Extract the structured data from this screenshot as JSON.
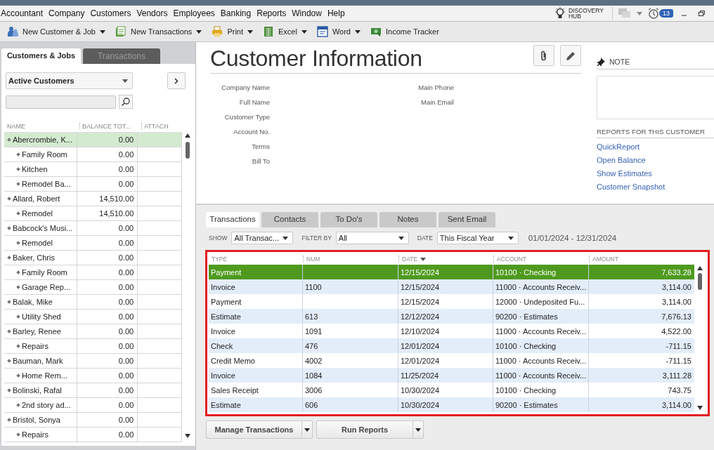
{
  "menu_bar": {
    "items": [
      "Accountant",
      "Company",
      "Customers",
      "Vendors",
      "Employees",
      "Banking",
      "Reports",
      "Window",
      "Help"
    ],
    "discovery_hub": "DISCOVERY HUB",
    "alerts_badge": "13"
  },
  "toolbar": {
    "items": [
      {
        "label": "New Customer & Job",
        "caret": true
      },
      {
        "label": "New Transactions",
        "caret": true
      },
      {
        "label": "Print",
        "caret": true
      },
      {
        "label": "Excel",
        "caret": true
      },
      {
        "label": "Word",
        "caret": true
      },
      {
        "label": "Income Tracker",
        "caret": false
      }
    ]
  },
  "customer_center": {
    "tabs": [
      {
        "label": "Customers & Jobs",
        "selected": true
      },
      {
        "label": "Transactions",
        "selected": false
      }
    ],
    "view_filter": "Active Customers",
    "columns": [
      "NAME",
      "BALANCE TOT...",
      "ATTACH"
    ],
    "customers": [
      {
        "name": "Abercrombie, K...",
        "balance": "0.00",
        "selected": true,
        "children": [
          {
            "name": "Family Room",
            "balance": "0.00",
            "selected": false
          },
          {
            "name": "Kitchen",
            "balance": "0.00",
            "selected": false
          },
          {
            "name": "Remodel Ba...",
            "balance": "0.00",
            "selected": false
          }
        ]
      },
      {
        "name": "Allard, Robert",
        "balance": "14,510.00",
        "selected": false,
        "children": [
          {
            "name": "Remodel",
            "balance": "14,510.00",
            "selected": false
          }
        ]
      },
      {
        "name": "Babcock's Musi...",
        "balance": "0.00",
        "selected": false,
        "children": [
          {
            "name": "Remodel",
            "balance": "0.00",
            "selected": false
          }
        ]
      },
      {
        "name": "Baker, Chris",
        "balance": "0.00",
        "selected": false,
        "children": [
          {
            "name": "Family Room",
            "balance": "0.00",
            "selected": false
          },
          {
            "name": "Garage Rep...",
            "balance": "0.00",
            "selected": false
          }
        ]
      },
      {
        "name": "Balak, Mike",
        "balance": "0.00",
        "selected": false,
        "children": [
          {
            "name": "Utility Shed",
            "balance": "0.00",
            "selected": false
          }
        ]
      },
      {
        "name": "Barley, Renee",
        "balance": "0.00",
        "selected": false,
        "children": [
          {
            "name": "Repairs",
            "balance": "0.00",
            "selected": false
          }
        ]
      },
      {
        "name": "Bauman, Mark",
        "balance": "0.00",
        "selected": false,
        "children": [
          {
            "name": "Home Rem...",
            "balance": "0.00",
            "selected": false
          }
        ]
      },
      {
        "name": "Bolinski, Rafal",
        "balance": "0.00",
        "selected": false,
        "children": [
          {
            "name": "2nd story ad...",
            "balance": "0.00",
            "selected": false
          }
        ]
      },
      {
        "name": "Bristol, Sonya",
        "balance": "0.00",
        "selected": false,
        "children": [
          {
            "name": "Repairs",
            "balance": "0.00",
            "selected": false
          }
        ]
      }
    ]
  },
  "customer_information": {
    "title": "Customer Information",
    "fields_left": [
      "Company Name",
      "Full Name",
      "Customer Type",
      "Account No.",
      "Terms",
      "Bill To"
    ],
    "fields_right": [
      "Main Phone",
      "Main Email"
    ],
    "note_label": "NOTE",
    "reports_heading": "REPORTS FOR THIS CUSTOMER",
    "report_links": [
      "QuickReport",
      "Open Balance",
      "Show Estimates",
      "Customer Snapshot"
    ]
  },
  "detail_tabs": [
    {
      "label": "Transactions",
      "selected": true
    },
    {
      "label": "Contacts",
      "selected": false
    },
    {
      "label": "To Do's",
      "selected": false
    },
    {
      "label": "Notes",
      "selected": false
    },
    {
      "label": "Sent Email",
      "selected": false
    }
  ],
  "filters": [
    {
      "label": "SHOW",
      "value": "All Transac..."
    },
    {
      "label": "FILTER BY",
      "value": "All"
    },
    {
      "label": "DATE",
      "value": "This Fiscal Year"
    }
  ],
  "date_range": "01/01/2024 - 12/31/2024",
  "transactions": {
    "columns": [
      {
        "label": "TYPE",
        "sorted": false
      },
      {
        "label": "NUM",
        "sorted": false
      },
      {
        "label": "DATE",
        "sorted": true
      },
      {
        "label": "ACCOUNT",
        "sorted": false
      },
      {
        "label": "AMOUNT",
        "sorted": false
      }
    ],
    "rows": [
      {
        "type": "Payment",
        "date": "12/15/2024",
        "account": "10100 · Checking",
        "amount": "7,633.28",
        "selected": true
      },
      {
        "type": "Invoice",
        "num": "1100",
        "date": "12/15/2024",
        "account": "11000 · Accounts Receiv...",
        "amount": "3,114.00",
        "selected": false
      },
      {
        "type": "Payment",
        "date": "12/15/2024",
        "account": "12000 · Undeposited Fu...",
        "amount": "3,114.00",
        "selected": false
      },
      {
        "type": "Estimate",
        "num": "613",
        "date": "12/12/2024",
        "account": "90200 · Estimates",
        "amount": "7,676.13",
        "selected": false
      },
      {
        "type": "Invoice",
        "num": "1091",
        "date": "12/10/2024",
        "account": "11000 · Accounts Receiv...",
        "amount": "4,522.00",
        "selected": false
      },
      {
        "type": "Check",
        "num": "476",
        "date": "12/01/2024",
        "account": "10100 · Checking",
        "amount": "-711.15",
        "selected": false
      },
      {
        "type": "Credit Memo",
        "num": "4002",
        "date": "12/01/2024",
        "account": "11000 · Accounts Receiv...",
        "amount": "-711.15",
        "selected": false
      },
      {
        "type": "Invoice",
        "num": "1084",
        "date": "11/25/2024",
        "account": "11000 · Accounts Receiv...",
        "amount": "3,111.28",
        "selected": false
      },
      {
        "type": "Sales Receipt",
        "num": "3006",
        "date": "10/30/2024",
        "account": "10100 · Checking",
        "amount": "743.75",
        "selected": false
      },
      {
        "type": "Estimate",
        "num": "606",
        "date": "10/30/2024",
        "account": "90200 · Estimates",
        "amount": "3,114.00",
        "selected": false
      }
    ]
  },
  "buttons": [
    "Manage Transactions",
    "Run Reports"
  ]
}
